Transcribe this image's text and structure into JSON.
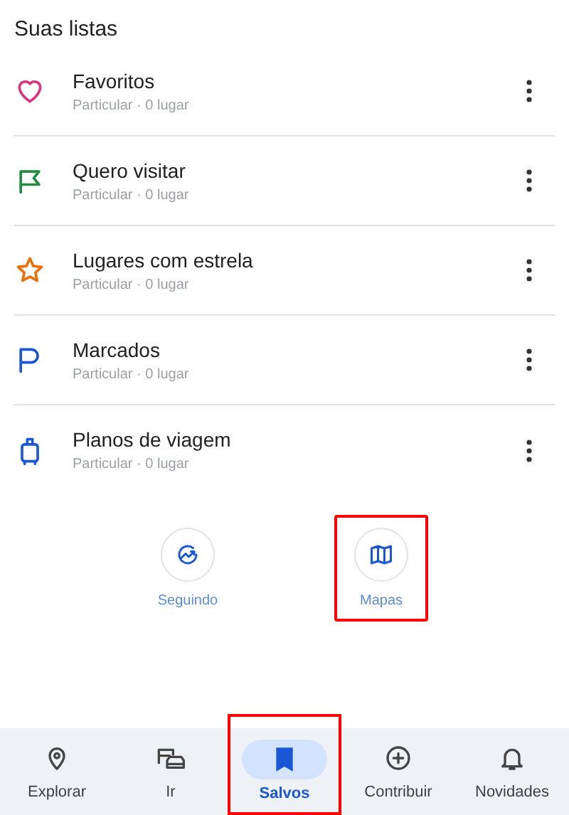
{
  "heading": "Suas listas",
  "lists": [
    {
      "kind": "heart",
      "color": "#e0307e",
      "name": "Favoritos",
      "visibility": "Particular",
      "separator": "·",
      "count": "0 lugar"
    },
    {
      "kind": "flag",
      "color": "#1e8e3e",
      "name": "Quero visitar",
      "visibility": "Particular",
      "separator": "·",
      "count": "0 lugar"
    },
    {
      "kind": "star",
      "color": "#e8710a",
      "name": "Lugares com estrela",
      "visibility": "Particular",
      "separator": "·",
      "count": "0 lugar"
    },
    {
      "kind": "pennant",
      "color": "#1a57d6",
      "name": "Marcados",
      "visibility": "Particular",
      "separator": "·",
      "count": "0 lugar"
    },
    {
      "kind": "luggage",
      "color": "#1a57d6",
      "name": "Planos de viagem",
      "visibility": "Particular",
      "separator": "·",
      "count": "0 lugar"
    }
  ],
  "shortcuts": [
    {
      "kind": "following",
      "label": "Seguindo",
      "highlighted": false
    },
    {
      "kind": "maps",
      "label": "Mapas",
      "highlighted": true
    }
  ],
  "nav": [
    {
      "kind": "explore",
      "label": "Explorar",
      "selected": false,
      "highlighted": false
    },
    {
      "kind": "go",
      "label": "Ir",
      "selected": false,
      "highlighted": false
    },
    {
      "kind": "saved",
      "label": "Salvos",
      "selected": true,
      "highlighted": true
    },
    {
      "kind": "contribute",
      "label": "Contribuir",
      "selected": false,
      "highlighted": false
    },
    {
      "kind": "updates",
      "label": "Novidades",
      "selected": false,
      "highlighted": false
    }
  ]
}
